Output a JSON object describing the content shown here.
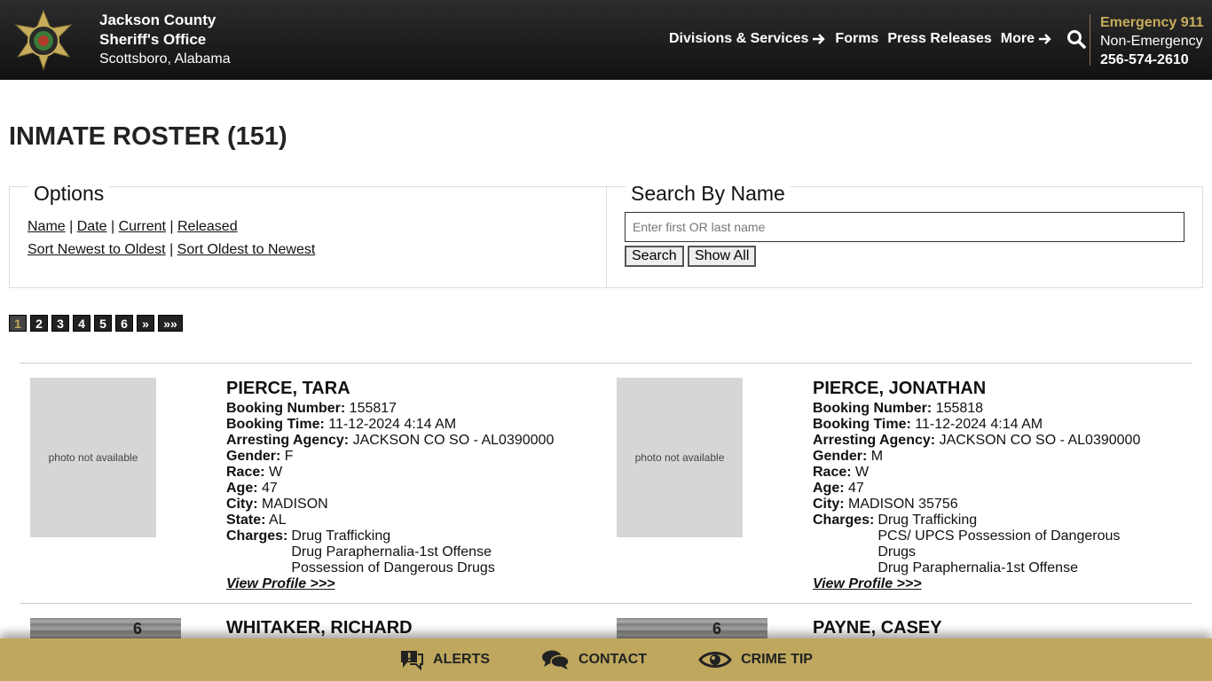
{
  "header": {
    "brand_line1": "Jackson County",
    "brand_line2": "Sheriff's Office",
    "brand_line3": "Scottsboro, Alabama",
    "nav": [
      {
        "label": "Divisions & Services",
        "arrow": true
      },
      {
        "label": "Forms",
        "arrow": false
      },
      {
        "label": "Press Releases",
        "arrow": false
      },
      {
        "label": "More",
        "arrow": true
      }
    ],
    "emergency": "Emergency 911",
    "non_emergency": "Non-Emergency",
    "phone": "256-574-2610"
  },
  "page": {
    "title": "INMATE ROSTER (151)"
  },
  "options": {
    "heading": "Options",
    "sort_links": [
      "Name",
      "Date",
      "Current",
      "Released"
    ],
    "order_links": [
      "Sort Newest to Oldest",
      "Sort Oldest to Newest"
    ]
  },
  "search": {
    "heading": "Search By Name",
    "placeholder": "Enter first OR last name",
    "search_label": "Search",
    "show_all_label": "Show All"
  },
  "pagination": {
    "pages": [
      "1",
      "2",
      "3",
      "4",
      "5",
      "6"
    ],
    "next": "»",
    "last": "»»",
    "current": "1"
  },
  "inmates": [
    {
      "photo_text": "photo not available",
      "name": "PIERCE, TARA",
      "booking_number": "155817",
      "booking_time": "11-12-2024 4:14 AM",
      "agency": "JACKSON CO SO - AL0390000",
      "gender": "F",
      "race": "W",
      "age": "47",
      "city": "MADISON",
      "state": "AL",
      "charges": [
        "Drug Trafficking",
        "Drug Paraphernalia-1st Offense",
        "Possession of Dangerous Drugs"
      ],
      "profile_link": "View Profile >>>"
    },
    {
      "photo_text": "photo not available",
      "name": "PIERCE, JONATHAN",
      "booking_number": "155818",
      "booking_time": "11-12-2024 4:14 AM",
      "agency": "JACKSON CO SO - AL0390000",
      "gender": "M",
      "race": "W",
      "age": "47",
      "city": "MADISON 35756",
      "charges": [
        "Drug Trafficking",
        "PCS/ UPCS Possession of Dangerous",
        "Drugs",
        "Drug Paraphernalia-1st Offense"
      ],
      "profile_link": "View Profile >>>"
    }
  ],
  "labels": {
    "booking_number": "Booking Number:",
    "booking_time": "Booking Time:",
    "agency": "Arresting Agency:",
    "gender": "Gender:",
    "race": "Race:",
    "age": "Age:",
    "city": "City:",
    "state": "State:",
    "charges": "Charges:"
  },
  "next_row": [
    {
      "name": "WHITAKER, RICHARD",
      "photo_number": "6"
    },
    {
      "name": "PAYNE, CASEY",
      "photo_number": "6"
    }
  ],
  "bottom_bar": {
    "alerts": "ALERTS",
    "contact": "CONTACT",
    "crime_tip": "CRIME TIP"
  },
  "colors": {
    "gold": "#bfa85e",
    "header_dark": "#111111",
    "gold_text": "#c7ac5b"
  }
}
